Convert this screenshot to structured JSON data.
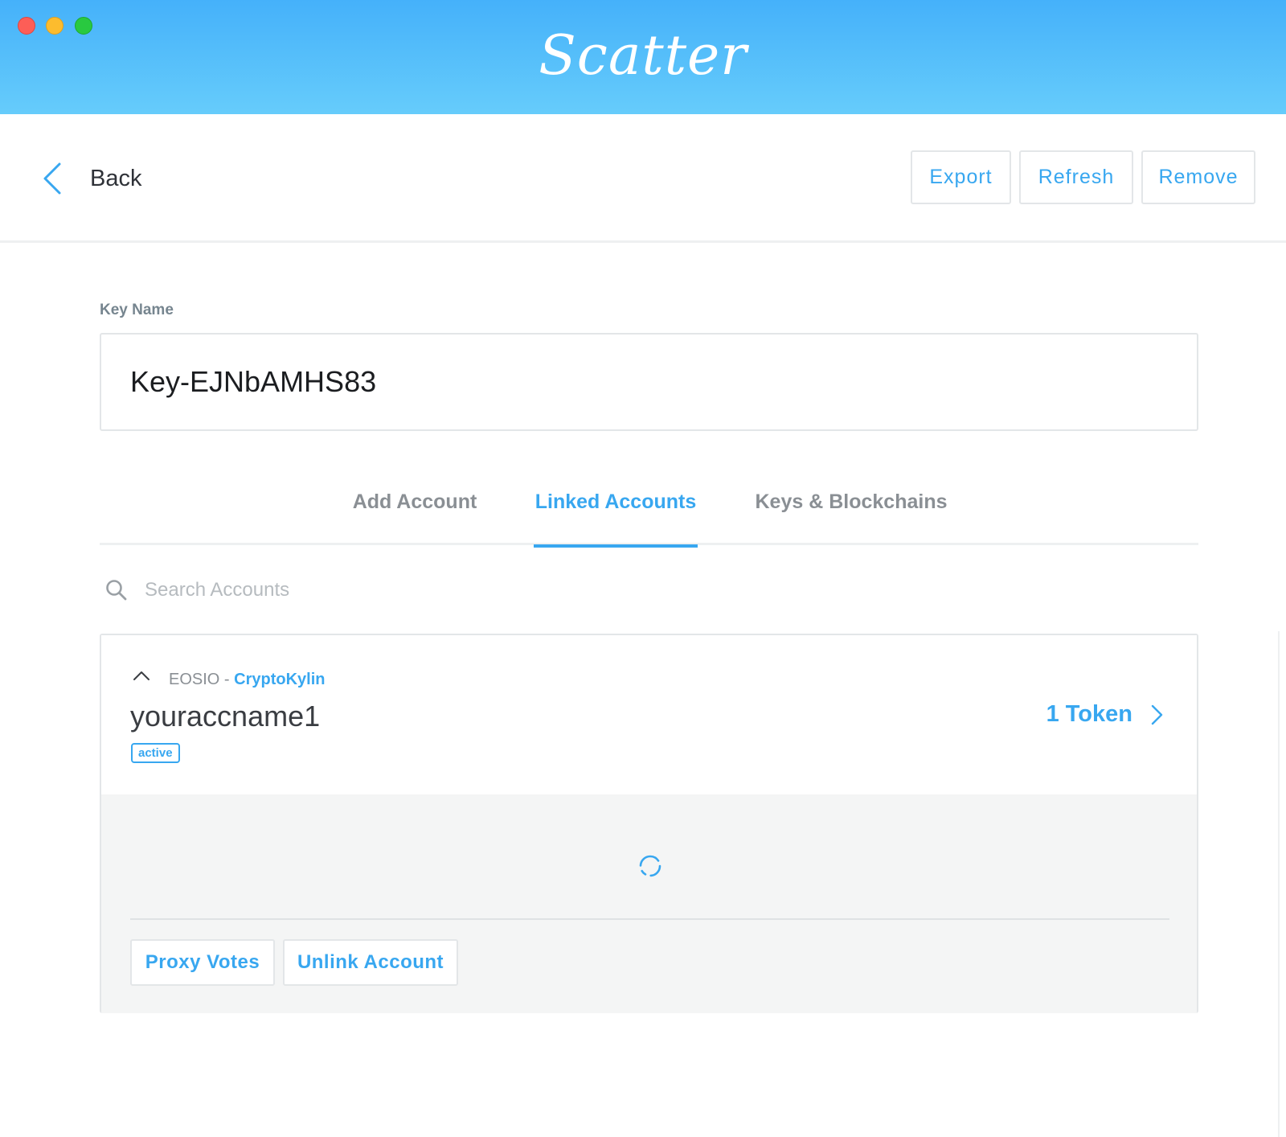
{
  "app": {
    "logo_text": "Scatter"
  },
  "toolbar": {
    "back_label": "Back",
    "export_label": "Export",
    "refresh_label": "Refresh",
    "remove_label": "Remove"
  },
  "key": {
    "label": "Key Name",
    "value": "Key-EJNbAMHS83"
  },
  "tabs": [
    {
      "label": "Add Account",
      "active": false
    },
    {
      "label": "Linked Accounts",
      "active": true
    },
    {
      "label": "Keys & Blockchains",
      "active": false
    }
  ],
  "search": {
    "placeholder": "Search Accounts",
    "icon": "search-icon"
  },
  "account": {
    "blockchain": "EOSIO",
    "separator": " - ",
    "network": "CryptoKylin",
    "name": "youraccname1",
    "permission": "active",
    "tokens_label": "1 Token",
    "proxy_votes_label": "Proxy Votes",
    "unlink_label": "Unlink Account"
  },
  "icons": {
    "back": "chevron-left-icon",
    "collapse": "chevron-up-icon",
    "tokens": "chevron-right-icon",
    "loading": "spinner-icon"
  },
  "colors": {
    "accent": "#38a7f0",
    "header_top": "#45b1fa",
    "header_bottom": "#66ccfb",
    "close": "#fd5e57",
    "minimize": "#fcbc2e",
    "zoom": "#29c940"
  }
}
